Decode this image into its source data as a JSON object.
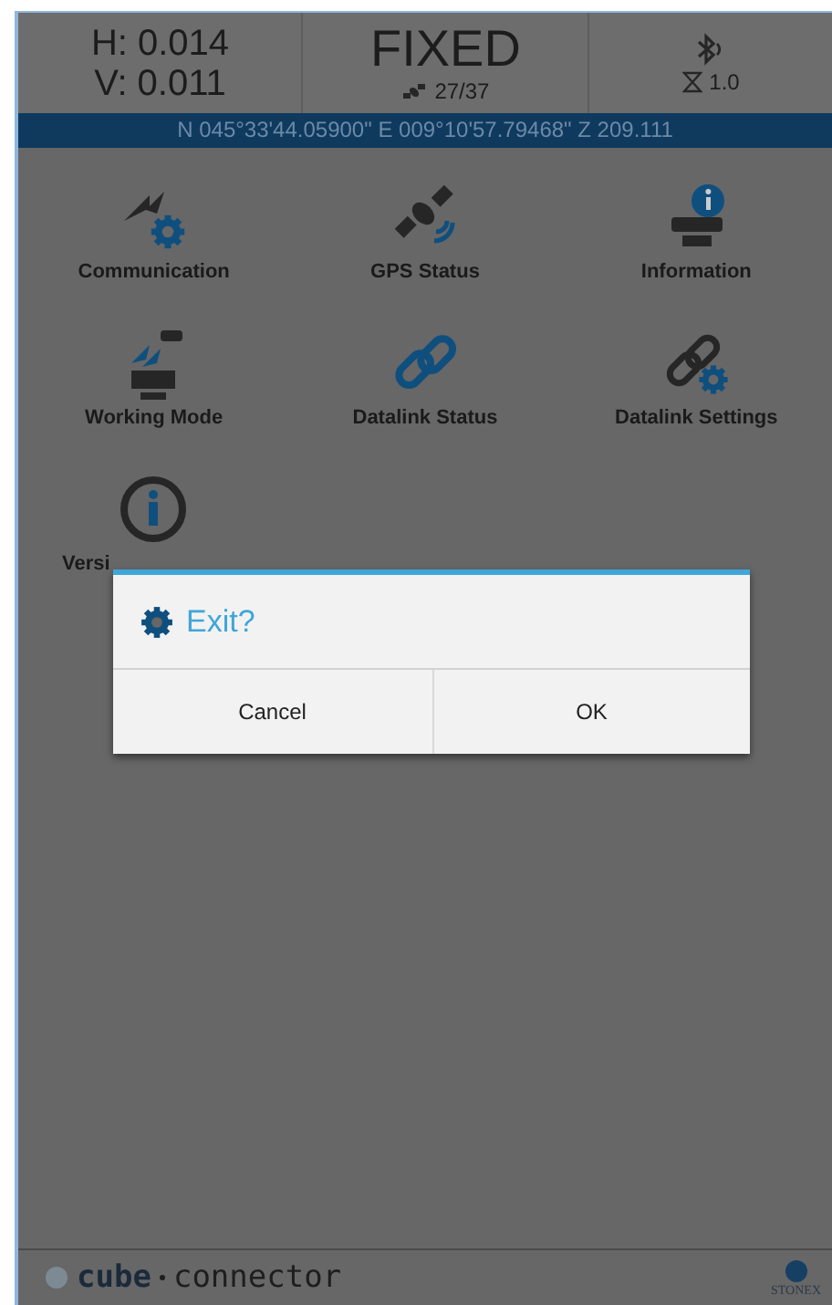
{
  "status": {
    "h": "H: 0.014",
    "v": "V: 0.011",
    "solution": "FIXED",
    "satellites": "27/37",
    "age": "1.0",
    "coordinates": "N 045°33'44.05900\" E 009°10'57.79468\" Z 209.111"
  },
  "menu": [
    {
      "label": "Communication",
      "kind": "communication"
    },
    {
      "label": "GPS Status",
      "kind": "satellite"
    },
    {
      "label": "Information",
      "kind": "information"
    },
    {
      "label": "Working Mode",
      "kind": "mode"
    },
    {
      "label": "Datalink Status",
      "kind": "link"
    },
    {
      "label": "Datalink Settings",
      "kind": "linksettings"
    },
    {
      "label": "Versi",
      "kind": "version"
    }
  ],
  "dialog": {
    "title": "Exit?",
    "buttons": [
      "Cancel",
      "OK"
    ]
  },
  "footer": {
    "logo": "cube",
    "logo_rest": "connector",
    "brand": "STONEX"
  }
}
